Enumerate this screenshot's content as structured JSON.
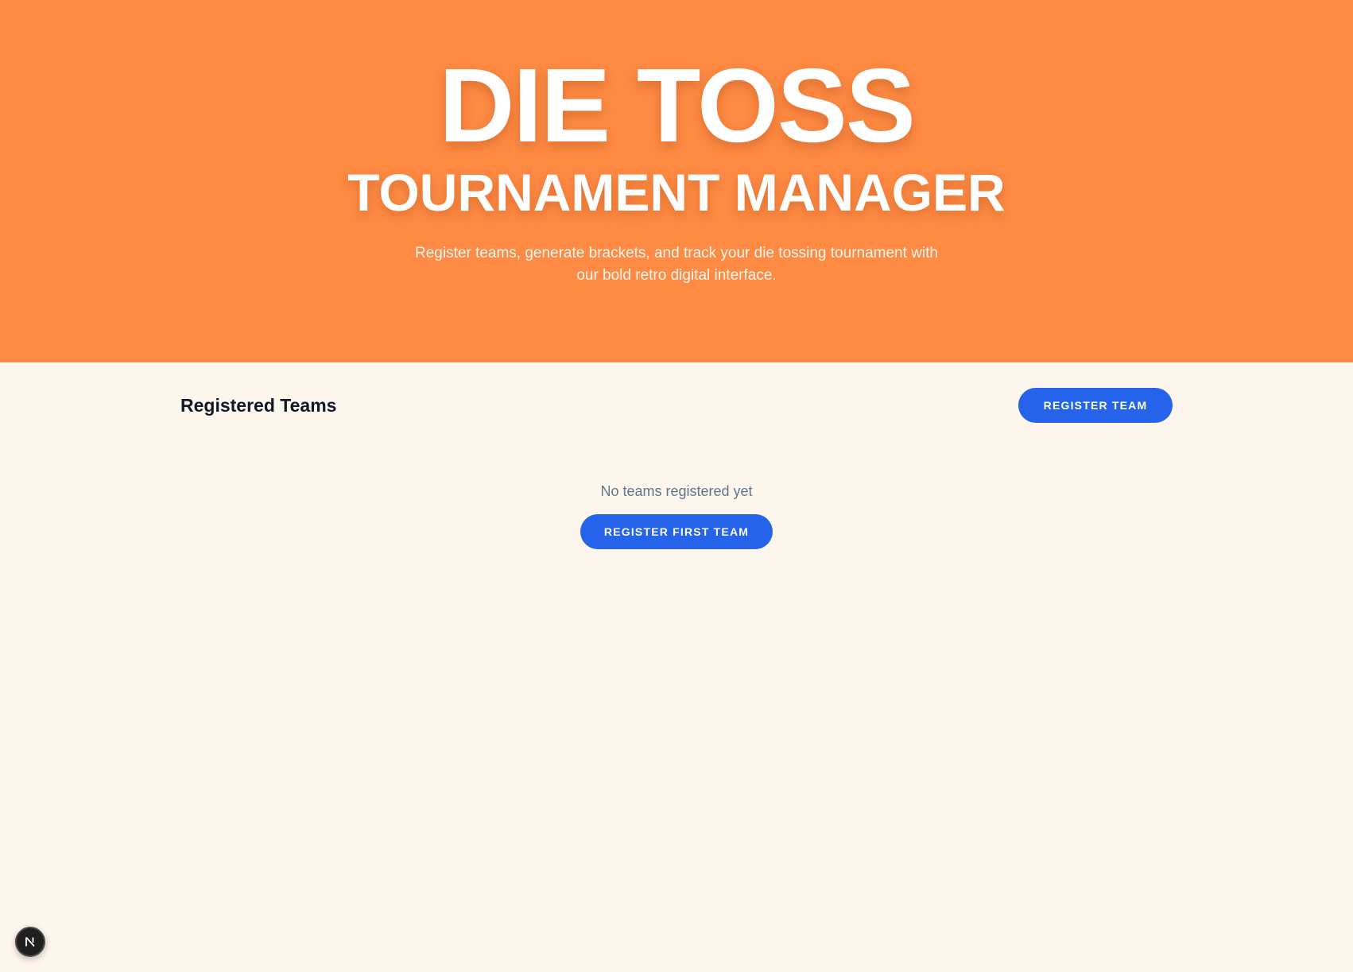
{
  "hero": {
    "title": "DIE TOSS",
    "subtitle": "TOURNAMENT MANAGER",
    "description": "Register teams, generate brackets, and track your die tossing tournament with our bold retro digital interface."
  },
  "teams_section": {
    "title": "Registered Teams",
    "register_button_label": "REGISTER TEAM",
    "empty_message": "No teams registered yet",
    "register_first_button_label": "REGISTER FIRST TEAM"
  },
  "dev_badge": {
    "icon": "nextjs-logo-icon"
  },
  "colors": {
    "hero_background": "#fe8a43",
    "page_background": "#fdf6ec",
    "primary_button": "#2563eb",
    "heading_text": "#111827",
    "muted_text": "#64748b"
  }
}
